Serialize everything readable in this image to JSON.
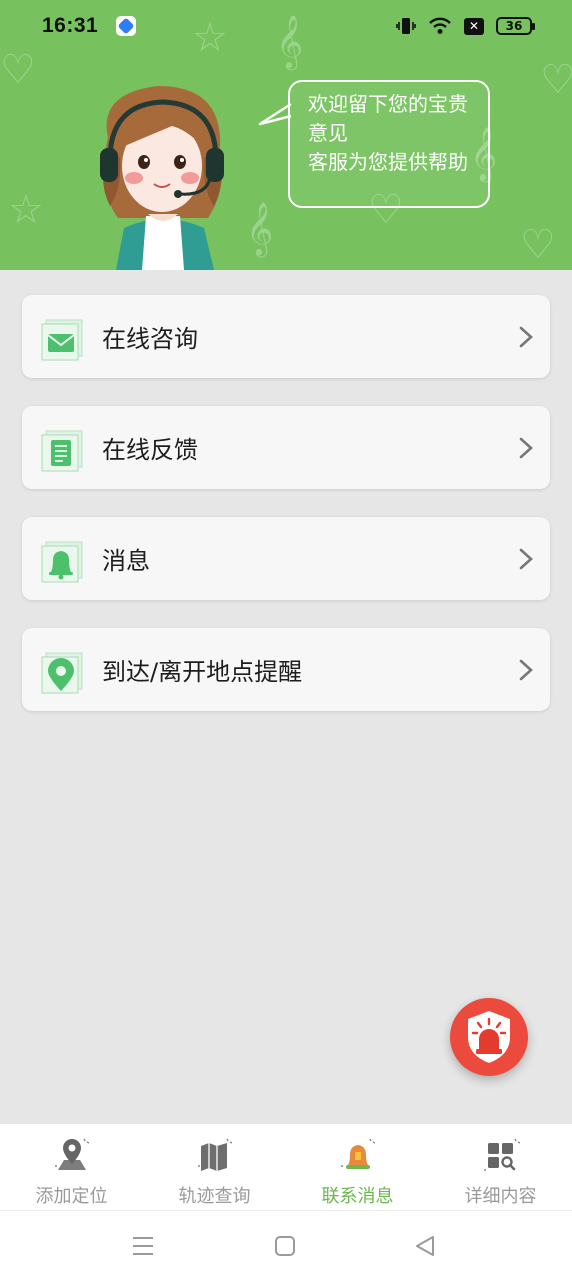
{
  "status_bar": {
    "time": "16:31",
    "battery": "36"
  },
  "header": {
    "bubble_line1": "欢迎留下您的宝贵意见",
    "bubble_line2": "客服为您提供帮助",
    "colors": {
      "background": "#77c25f"
    }
  },
  "menu": {
    "items": [
      {
        "label": "在线咨询",
        "icon": "envelope-icon"
      },
      {
        "label": "在线反馈",
        "icon": "document-icon"
      },
      {
        "label": "消息",
        "icon": "bell-icon"
      },
      {
        "label": "到达/离开地点提醒",
        "icon": "location-pin-icon"
      }
    ]
  },
  "fab": {
    "icon": "alarm-siren-icon",
    "color": "#ec4a3c"
  },
  "bottom_nav": {
    "items": [
      {
        "label": "添加定位",
        "icon": "map-pin-icon",
        "active": false
      },
      {
        "label": "轨迹查询",
        "icon": "folded-map-icon",
        "active": false
      },
      {
        "label": "联系消息",
        "icon": "bell-icon",
        "active": true
      },
      {
        "label": "详细内容",
        "icon": "grid-search-icon",
        "active": false
      }
    ],
    "active_color": "#6cb74f"
  }
}
